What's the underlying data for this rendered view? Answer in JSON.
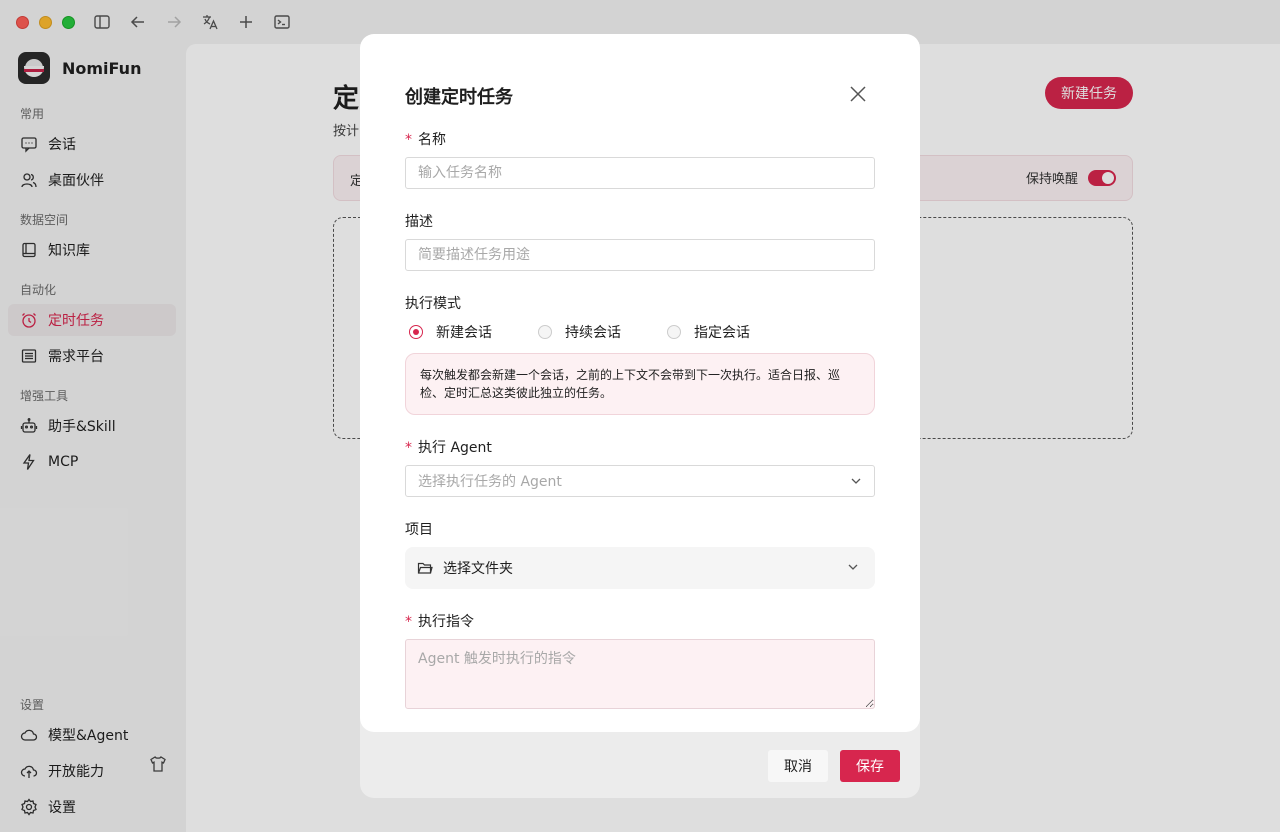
{
  "app": {
    "name": "NomiFun"
  },
  "sidebar": {
    "groups": {
      "common": "常用",
      "data_space": "数据空间",
      "automation": "自动化",
      "enhance": "增强工具",
      "settings": "设置"
    },
    "items": {
      "chat": "会话",
      "desktop_partner": "桌面伙伴",
      "knowledge": "知识库",
      "scheduled": "定时任务",
      "requirements": "需求平台",
      "assistant_skill": "助手&Skill",
      "mcp": "MCP",
      "model_agent": "模型&Agent",
      "open_ability": "开放能力",
      "settings": "设置"
    },
    "active": "scheduled"
  },
  "main": {
    "title": "定",
    "subtitle": "按计",
    "new_task_button": "新建任务",
    "banner_left": "定",
    "keep_awake_label": "保持唤醒",
    "keep_awake_on": true
  },
  "modal": {
    "title": "创建定时任务",
    "name": {
      "label": "名称",
      "required": "*",
      "placeholder": "输入任务名称"
    },
    "description": {
      "label": "描述",
      "placeholder": "简要描述任务用途"
    },
    "mode": {
      "label": "执行模式",
      "options": [
        "新建会话",
        "持续会话",
        "指定会话"
      ],
      "selected": "新建会话",
      "hint": "每次触发都会新建一个会话，之前的上下文不会带到下一次执行。适合日报、巡检、定时汇总这类彼此独立的任务。"
    },
    "agent": {
      "label": "执行 Agent",
      "required": "*",
      "placeholder": "选择执行任务的 Agent"
    },
    "project": {
      "label": "项目",
      "placeholder": "选择文件夹"
    },
    "instruction": {
      "label": "执行指令",
      "required": "*",
      "placeholder": "Agent 触发时执行的指令"
    },
    "cancel_button": "取消",
    "save_button": "保存"
  },
  "colors": {
    "accent": "#d7264e",
    "hint_bg": "#fdf1f3"
  }
}
